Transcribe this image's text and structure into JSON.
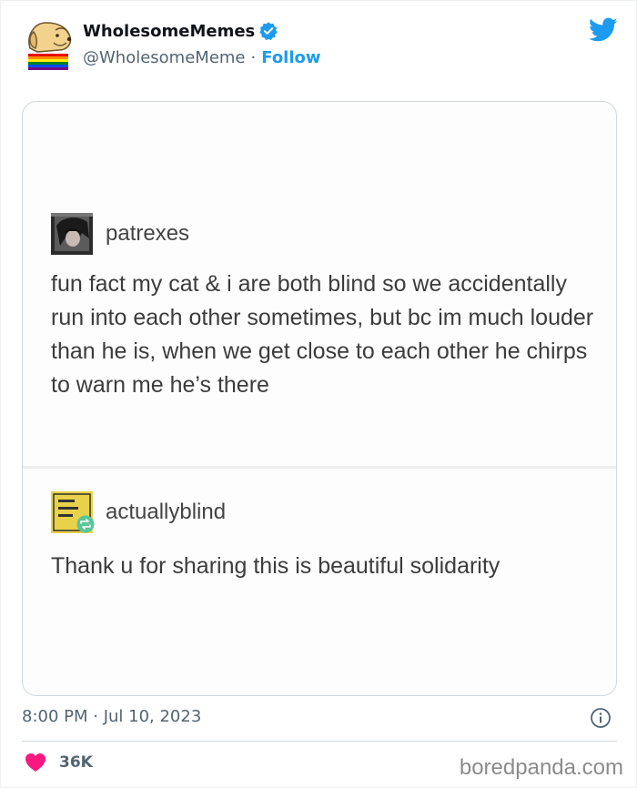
{
  "tweet": {
    "author": {
      "display_name": "WholesomeMemes",
      "handle": "@WholesomeMeme",
      "separator": "·",
      "follow_label": "Follow",
      "verified_icon": "verified-badge-icon",
      "avatar_icon": "dog-avatar-icon"
    },
    "timestamp": "8:00 PM · Jul 10, 2023",
    "likes": {
      "count": "36K",
      "icon": "heart-icon",
      "color": "#f91880"
    },
    "brand_icon": "twitter-bird-icon",
    "accent_color": "#1d9bf0"
  },
  "embedded_media": {
    "posts": [
      {
        "username": "patrexes",
        "text": "fun fact my cat & i are both blind so we accidentally run into each other sometimes, but bc im much louder than he is, when we get close to each other he chirps to warn me he’s there"
      },
      {
        "username": "actuallyblind",
        "text": "Thank u for sharing this is beautiful solidarity"
      }
    ]
  },
  "watermark": "boredpanda.com"
}
